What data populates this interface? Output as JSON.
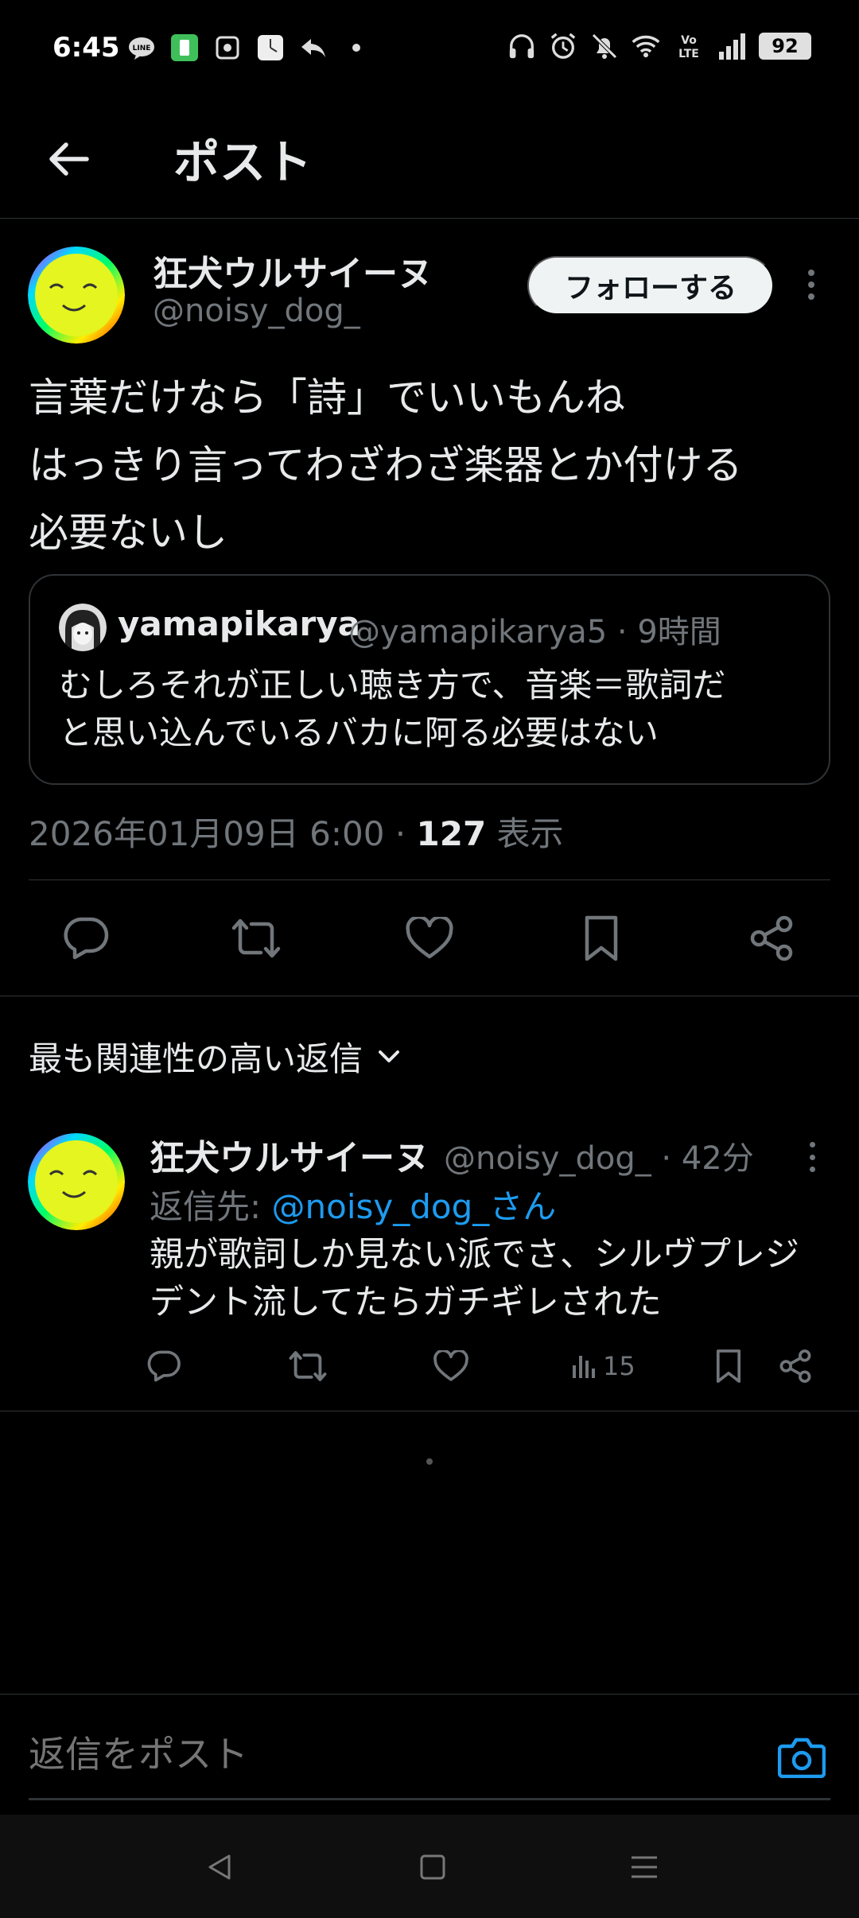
{
  "status_bar": {
    "time": "6:45",
    "battery": "92",
    "left_icons": [
      "line-icon",
      "app-icon",
      "app2-icon",
      "clock-app-icon",
      "reply-notif-icon",
      "dot-icon"
    ],
    "right_icons": [
      "headphones-icon",
      "alarm-icon",
      "mute-icon",
      "wifi-icon",
      "volte-icon",
      "signal-icon"
    ],
    "volte_label": "Vo LTE"
  },
  "header": {
    "title": "ポスト",
    "back_icon": "arrow-left-icon"
  },
  "post": {
    "author_name": "狂犬ウルサイーヌ",
    "author_handle": "@noisy_dog_",
    "follow_label": "フォローする",
    "text_lines": [
      "言葉だけなら「詩」でいいもんね",
      "はっきり言ってわざわざ楽器とか付ける",
      "必要ないし"
    ],
    "quote": {
      "name": "yamapikarya",
      "handle_time": "@yamapikarya5 · 9時間",
      "text_lines": [
        "むしろそれが正しい聴き方で、音楽＝歌詞だ",
        "と思い込んでいるバカに阿る必要はない"
      ]
    },
    "timestamp": "2026年01月09日 6:00 · ",
    "views_count": "127",
    "views_label": " 表示"
  },
  "actions": [
    "reply-icon",
    "retweet-icon",
    "like-icon",
    "bookmark-icon",
    "share-icon"
  ],
  "replies": {
    "sort_label": "最も関連性の高い返信",
    "items": [
      {
        "author_name": "狂犬ウルサイーヌ",
        "handle_time": "@noisy_dog_ · 42分",
        "reply_to_prefix": "返信先: ",
        "reply_to_mention": "@noisy_dog_さん",
        "text_lines": [
          "親が歌詞しか見ない派でさ、シルヴプレジ",
          "デント流してたらガチギレされた"
        ],
        "views": "15"
      }
    ]
  },
  "composer": {
    "placeholder": "返信をポスト"
  },
  "colors": {
    "background": "#000000",
    "text": "#e7e9ea",
    "muted": "#71767b",
    "accent": "#1d9bf0",
    "border": "#2f3336"
  }
}
